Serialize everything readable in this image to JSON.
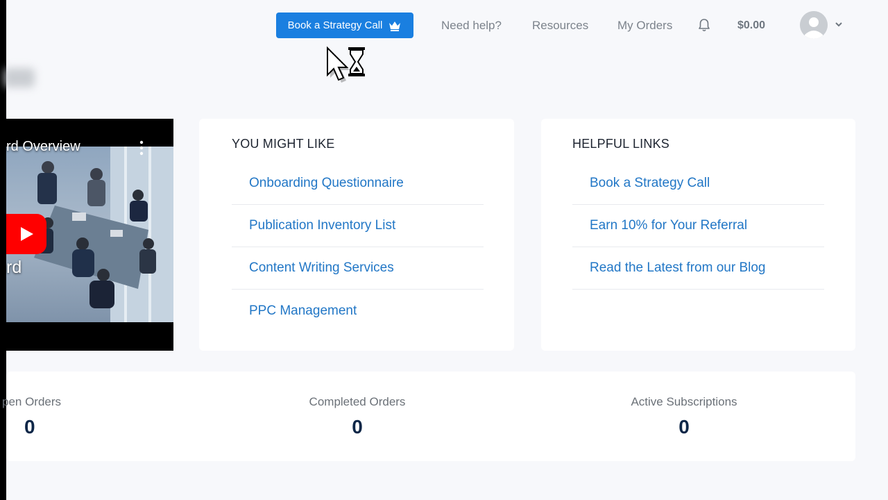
{
  "header": {
    "cta_label": "Book a Strategy Call",
    "nav": [
      "Need help?",
      "Resources",
      "My Orders"
    ],
    "balance": "$0.00",
    "brand_color": "#1a7fe0",
    "icons": [
      "crown-icon",
      "bell-icon",
      "avatar-icon",
      "chevron-down-icon"
    ]
  },
  "video": {
    "title_fragment": "rd Overview",
    "subtitle_fragment": "rd"
  },
  "you_might_like": {
    "title": "YOU MIGHT LIKE",
    "items": [
      "Onboarding Questionnaire",
      "Publication Inventory List",
      "Content Writing Services",
      "PPC Management"
    ]
  },
  "helpful_links": {
    "title": "HELPFUL LINKS",
    "items": [
      "Book a Strategy Call",
      "Earn 10% for Your Referral",
      "Read the Latest from our Blog"
    ]
  },
  "stats": [
    {
      "label": "pen Orders",
      "value": "0"
    },
    {
      "label": "Completed Orders",
      "value": "0"
    },
    {
      "label": "Active Subscriptions",
      "value": "0"
    }
  ],
  "link_color": "#2277c6"
}
